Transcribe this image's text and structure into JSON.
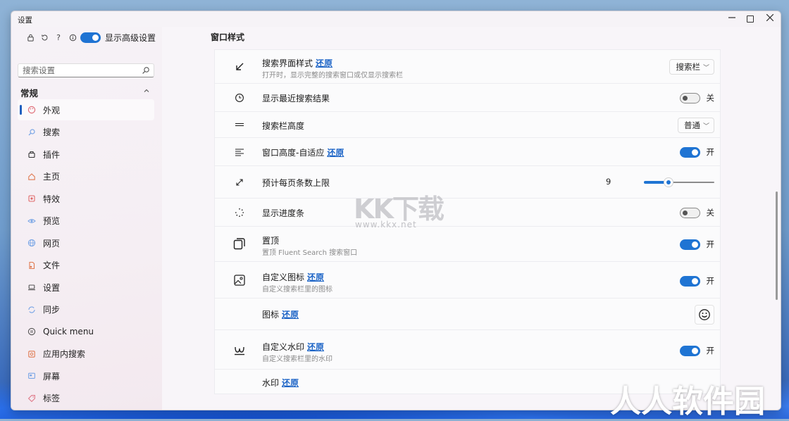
{
  "window": {
    "title": "设置"
  },
  "sidebar": {
    "advanced_label": "显示高级设置",
    "search_placeholder": "搜索设置",
    "section_title": "常规",
    "items": [
      {
        "label": "外观",
        "icon": "palette-icon"
      },
      {
        "label": "搜索",
        "icon": "search-icon"
      },
      {
        "label": "插件",
        "icon": "plugin-icon"
      },
      {
        "label": "主页",
        "icon": "home-icon"
      },
      {
        "label": "特效",
        "icon": "effects-icon"
      },
      {
        "label": "预览",
        "icon": "eye-icon"
      },
      {
        "label": "网页",
        "icon": "globe-icon"
      },
      {
        "label": "文件",
        "icon": "file-icon"
      },
      {
        "label": "设置",
        "icon": "laptop-icon"
      },
      {
        "label": "同步",
        "icon": "sync-icon"
      },
      {
        "label": "Quick menu",
        "icon": "menu-icon"
      },
      {
        "label": "应用内搜索",
        "icon": "app-search-icon"
      },
      {
        "label": "屏幕",
        "icon": "screen-icon"
      },
      {
        "label": "标签",
        "icon": "tag-icon"
      }
    ]
  },
  "main": {
    "page_title": "窗口样式",
    "reset_label": "还原",
    "rows": [
      {
        "title": "搜索界面样式",
        "subtitle": "打开时，显示完整的搜索窗口或仅显示搜索栏",
        "control": "dropdown",
        "value": "搜索栏",
        "icon": "collapse-arrow-icon"
      },
      {
        "title": "显示最近搜索结果",
        "control": "toggle",
        "state": "关",
        "icon": "clock-icon"
      },
      {
        "title": "搜索栏高度",
        "control": "dropdown",
        "value": "普通",
        "icon": "height-lines-icon"
      },
      {
        "title": "窗口高度-自适应",
        "control": "toggle",
        "state": "开",
        "icon": "text-lines-icon"
      },
      {
        "title": "预计每页条数上限",
        "control": "slider",
        "value": 9,
        "icon": "resize-arrows-icon"
      },
      {
        "title": "显示进度条",
        "control": "toggle",
        "state": "关",
        "icon": "spinner-icon"
      },
      {
        "title": "置顶",
        "subtitle": "置顶 Fluent Search 搜索窗口",
        "control": "toggle",
        "state": "开",
        "icon": "layers-icon"
      },
      {
        "title": "自定义图标",
        "subtitle": "自定义搜索栏里的图标",
        "control": "toggle",
        "state": "开",
        "icon": "image-icon"
      },
      {
        "title": "图标",
        "control": "icon-button",
        "icon": "smiley-icon"
      },
      {
        "title": "自定义水印",
        "subtitle": "自定义搜索栏里的水印",
        "control": "toggle",
        "state": "开",
        "icon": "watermark-icon"
      },
      {
        "title": "水印"
      }
    ]
  },
  "overlays": {
    "wm1": "KK下载",
    "wm1_sub": "www.kkx.net",
    "wm2": "人人软件园"
  },
  "colors": {
    "accent": "#1f74d3",
    "link": "#1b63c6"
  }
}
